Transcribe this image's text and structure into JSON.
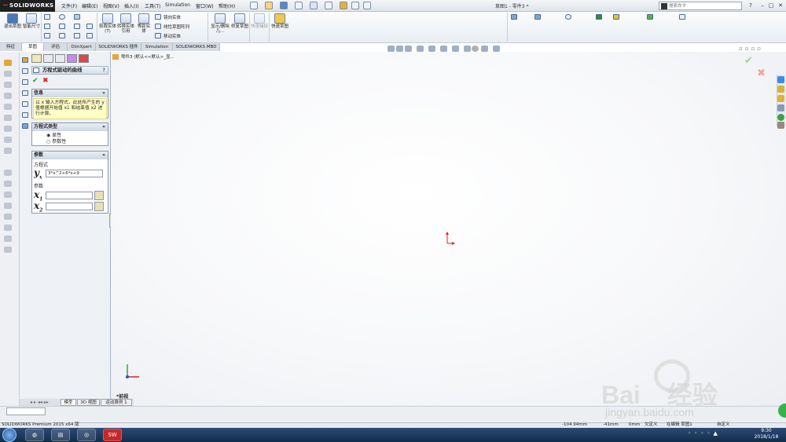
{
  "app": {
    "name": "SOLIDWORKS",
    "doc_title": "草图1 - 零件3 *"
  },
  "menu": [
    "文件(F)",
    "编辑(E)",
    "视图(V)",
    "插入(I)",
    "工具(T)",
    "Simulation",
    "窗口(W)",
    "帮助(H)"
  ],
  "search": {
    "placeholder": "搜索命令"
  },
  "ribbon": {
    "exit_sketch": "退出草图",
    "smart_dim": "智能尺寸",
    "trim": "剪裁实体(T)",
    "convert": "转换实体引用",
    "offset": "等距实体",
    "mirror": "镜向实体",
    "linear_pattern": "线性草图阵列",
    "move": "移动实体",
    "show_relations": "显示/删除几...",
    "repair": "修复草图",
    "quick_snaps": "快速捕捉",
    "rapid_sketch": "快速草图"
  },
  "tabs": [
    "特征",
    "草图",
    "评估",
    "DimXpert",
    "SOLIDWORKS 插件",
    "Simulation",
    "SOLIDWORKS MBD"
  ],
  "tree_path": "零件3 (默认<<默认>_显...",
  "pm": {
    "title": "方程式驱动的曲线",
    "info_title": "信息",
    "info_text": "以 x 输入方程式，此处所产生的 y 值根据开始值 x1 和结束值 x2 进行计算。",
    "eq_type_title": "方程式类型",
    "options": [
      "显性",
      "参数性"
    ],
    "params_title": "参数",
    "eq_label": "方程式",
    "eq_value": "3*x^2+6*x+9",
    "param_label": "参数",
    "yx": "y",
    "yx_sub": "x",
    "x1": "x",
    "x1_sub": "1",
    "x2": "x",
    "x2_sub": "2"
  },
  "view_label": "*前视",
  "bottom_tabs": [
    "模型",
    "3D 视图",
    "运动算例 1"
  ],
  "status": {
    "product": "SOLIDWORKS Premium 2015 x64 版",
    "x": "-104.94mm",
    "y": "-41mm",
    "z": "0mm",
    "defined": "欠定义",
    "editing": "在编辑 草图1",
    "units": "自定义"
  },
  "taskbar": {
    "time": "9:30",
    "date": "2018/1/18"
  },
  "watermark": {
    "line1": "Bai",
    "line2": "经验",
    "url": "jingyan.baidu.com"
  }
}
